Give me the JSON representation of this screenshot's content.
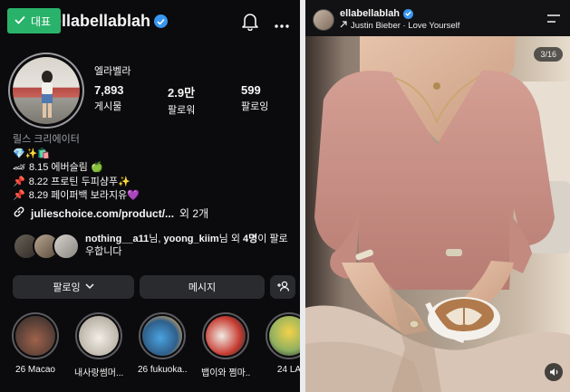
{
  "left_panel": {
    "tag_label": "대표",
    "username": "ellabellablah",
    "username_partial": "ellabellablah",
    "display_name": "엘라벨라",
    "stats": [
      {
        "count": "7,893",
        "label": "게시물"
      },
      {
        "count": "2.9만",
        "label": "팔로워"
      },
      {
        "count": "599",
        "label": "팔로잉"
      }
    ],
    "category": "릴스 크리에이터",
    "bio_lines": [
      {
        "emoji": "💎✨🛍️",
        "text": ""
      },
      {
        "emoji": "🏎",
        "text": "8.15 에버슬림 🍏"
      },
      {
        "emoji": "📌",
        "text": "8.22 프로틴 두피샴푸✨"
      },
      {
        "emoji": "📌",
        "text": "8.29 페이퍼백 보라지유💜"
      }
    ],
    "link_text": "julieschoice.com/product/...",
    "link_more": "외 2개",
    "followed_by": {
      "user1": "nothing__a11",
      "suffix1": "님, ",
      "user2": "yoong_kiim",
      "suffix2": "님 외 ",
      "count": "4명",
      "suffix3": "이 팔로우합니다"
    },
    "buttons": {
      "following": "팔로잉",
      "message": "메시지"
    },
    "highlights": [
      {
        "label": "26 Macao",
        "color": "#8a5a4a"
      },
      {
        "label": "내사랑썸머...",
        "color": "#e8e2d6"
      },
      {
        "label": "26 fukuoka...",
        "color": "#4a90c8"
      },
      {
        "label": "뱁이와 쩜마...",
        "color": "#d8c8b0"
      },
      {
        "label": "24 LA",
        "color": "#e0c040"
      }
    ],
    "icons": [
      "check-icon",
      "verified-badge-icon",
      "bell-icon",
      "more-icon",
      "link-icon",
      "chevron-down-icon",
      "add-person-icon"
    ]
  },
  "right_panel": {
    "username": "ellabellablah",
    "music": "Justin Bieber · Love Yourself",
    "counter": "3/16",
    "icons": [
      "verified-badge-icon",
      "music-arrow-icon",
      "menu-icon",
      "sound-icon"
    ]
  }
}
